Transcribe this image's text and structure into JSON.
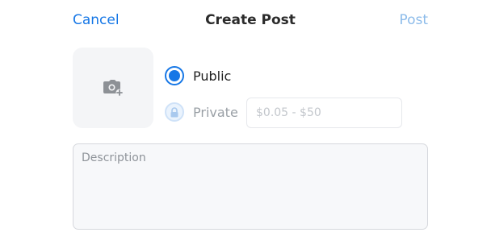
{
  "header": {
    "cancel_label": "Cancel",
    "title": "Create Post",
    "post_label": "Post"
  },
  "media": {
    "icon": "camera-add-icon"
  },
  "visibility": {
    "selected": "public",
    "public_label": "Public",
    "private_label": "Private"
  },
  "price": {
    "value": "",
    "placeholder": "$0.05 - $50"
  },
  "description": {
    "value": "",
    "placeholder": "Description"
  },
  "colors": {
    "accent": "#1677e6",
    "post_disabled": "#8cbbea",
    "muted_text": "#9aa0a6"
  }
}
